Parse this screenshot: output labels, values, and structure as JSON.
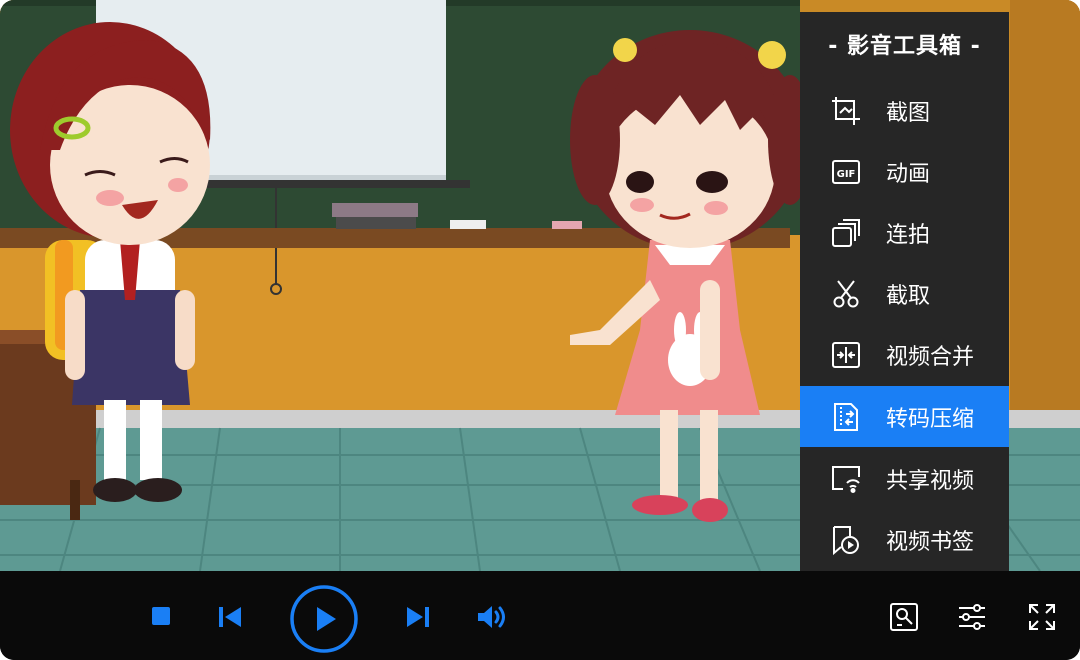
{
  "colors": {
    "accent": "#1a7ff5",
    "menu_bg": "#262626",
    "control_bar_bg": "#0a0a0a",
    "icon_white": "#ffffff"
  },
  "video": {
    "scene": "cartoon classroom with two girls"
  },
  "toolbox": {
    "title": "- 影音工具箱 -",
    "items": [
      {
        "label": "截图",
        "icon": "screenshot-icon",
        "active": false
      },
      {
        "label": "动画",
        "icon": "gif-icon",
        "active": false
      },
      {
        "label": "连拍",
        "icon": "burst-shot-icon",
        "active": false
      },
      {
        "label": "截取",
        "icon": "scissors-icon",
        "active": false
      },
      {
        "label": "视频合并",
        "icon": "merge-icon",
        "active": false
      },
      {
        "label": "转码压缩",
        "icon": "transcode-compress-icon",
        "active": true
      },
      {
        "label": "共享视频",
        "icon": "share-video-icon",
        "active": false
      },
      {
        "label": "视频书签",
        "icon": "bookmark-icon",
        "active": false
      }
    ]
  },
  "controls": {
    "left": [
      "stop-icon",
      "previous-icon",
      "play-icon",
      "next-icon",
      "volume-icon"
    ],
    "right": [
      "toolbox-icon",
      "settings-sliders-icon",
      "fullscreen-icon"
    ]
  }
}
